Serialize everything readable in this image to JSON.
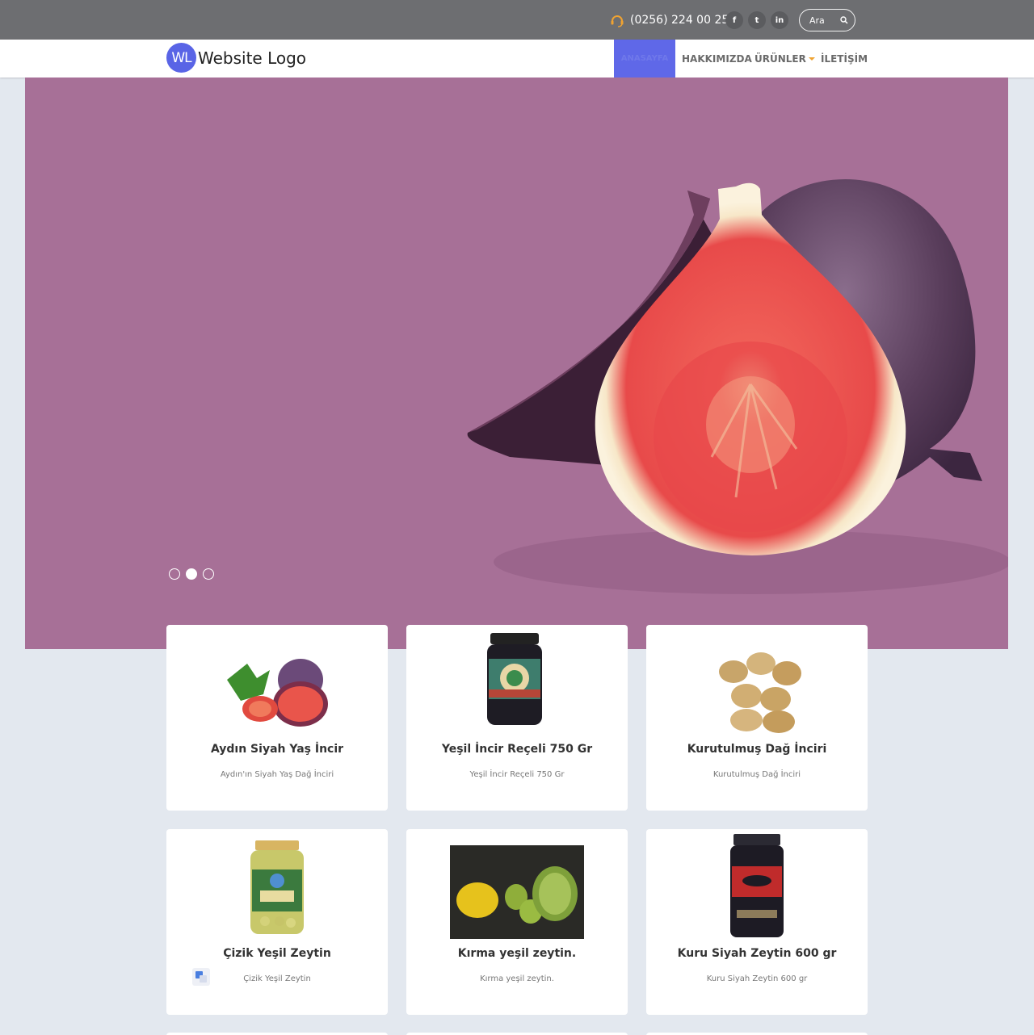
{
  "topbar": {
    "phone": "(0256) 224 00 25",
    "social": [
      {
        "icon": "facebook-icon",
        "glyph": "f"
      },
      {
        "icon": "twitter-icon",
        "glyph": "t"
      },
      {
        "icon": "linkedin-icon",
        "glyph": "in"
      }
    ],
    "search_placeholder": "Ara"
  },
  "header": {
    "logo_badge": "WL",
    "logo_text": "Website Logo",
    "nav": {
      "home": "ANASAYFA",
      "about": "HAKKIMIZDA",
      "products": "ÜRÜNLER",
      "contact": "İLETİŞİM"
    }
  },
  "hero": {
    "slide_count": 3,
    "active_slide": 2
  },
  "products": [
    {
      "title": "Aydın Siyah Yaş İncir",
      "desc": "Aydın'ın Siyah Yaş Dağ İnciri"
    },
    {
      "title": "Yeşil İncir Reçeli 750 Gr",
      "desc": "Yeşil İncir Reçeli 750 Gr"
    },
    {
      "title": "Kurutulmuş Dağ İnciri",
      "desc": "Kurutulmuş Dağ İnciri"
    },
    {
      "title": "Çizik Yeşil Zeytin",
      "desc": "Çizik Yeşil Zeytin"
    },
    {
      "title": "Kırma yeşil zeytin.",
      "desc": "Kırma yeşil zeytin."
    },
    {
      "title": "Kuru Siyah Zeytin 600 gr",
      "desc": "Kuru Siyah Zeytin 600 gr"
    }
  ],
  "colors": {
    "topbar": "#6d6e71",
    "accent": "#5f68e8",
    "hero_bg": "#a77097",
    "page_bg": "#e3e8ef"
  }
}
